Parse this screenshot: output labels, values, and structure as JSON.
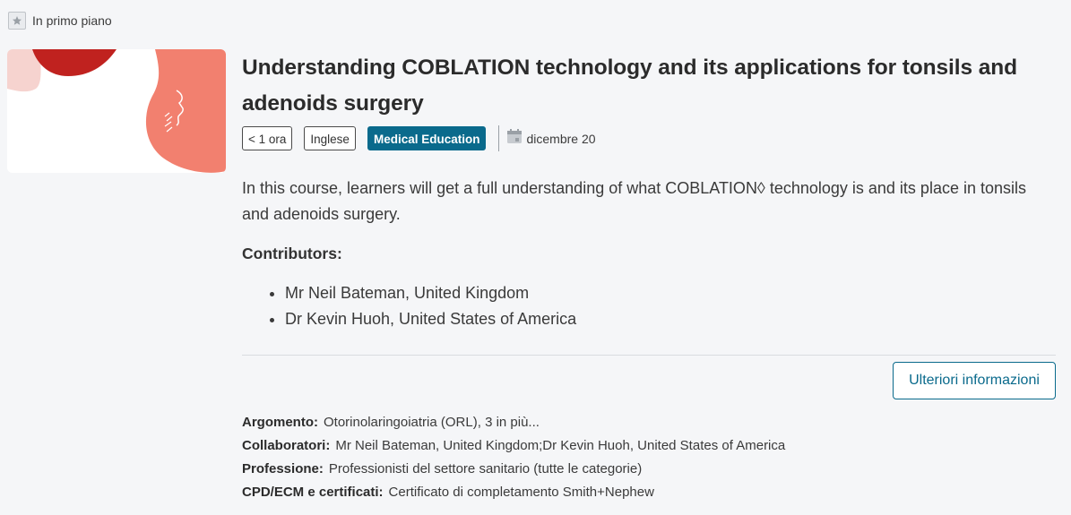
{
  "featured": {
    "label": "In primo piano",
    "icon": "star-icon"
  },
  "course": {
    "title": "Understanding COBLATION technology and its applications for tonsils and adenoids surgery",
    "tags": {
      "duration": "< 1 ora",
      "language": "Inglese",
      "category": "Medical Education"
    },
    "date": "dicembre 20",
    "date_icon": "calendar-icon",
    "description": "In this course, learners will get a full understanding of what COBLATION◊ technology is and its place in tonsils and adenoids surgery.",
    "contributors_heading": "Contributors:",
    "contributors": [
      "Mr Neil Bateman, United Kingdom",
      "Dr Kevin Huoh, United States of America"
    ],
    "more_button": "Ulteriori informazioni",
    "details": [
      {
        "key": "Argomento:",
        "value": "Otorinolaringoiatria (ORL), 3 in più..."
      },
      {
        "key": "Collaboratori:",
        "value": "Mr Neil Bateman, United Kingdom;Dr Kevin Huoh, United States of America"
      },
      {
        "key": "Professione:",
        "value": "Professionisti del settore sanitario (tutte le categorie)"
      },
      {
        "key": "CPD/ECM e certificati:",
        "value": "Certificato di completamento Smith+Nephew"
      }
    ]
  },
  "colors": {
    "accent": "#0a6a8c",
    "background": "#f5f6f8",
    "thumb_coral": "#f2806f",
    "thumb_red": "#c0221f",
    "thumb_pink": "#f6d3cf"
  }
}
